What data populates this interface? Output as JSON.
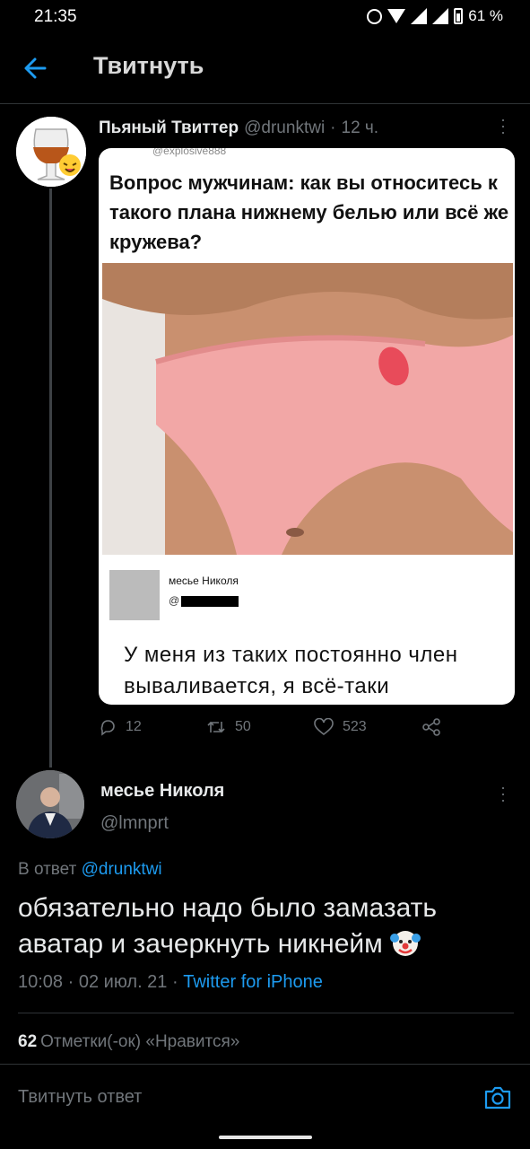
{
  "status_bar": {
    "time": "21:35",
    "battery": "61 %"
  },
  "header": {
    "title": "Твитнуть",
    "back_icon": "arrow-left-icon"
  },
  "quoted_tweet": {
    "name": "Пьяный Твиттер",
    "handle": "@drunktwi",
    "separator": "·",
    "time": "12 ч.",
    "card": {
      "clipped_handle": "@explosive888",
      "question": "Вопрос мужчинам: как вы относитесь к такого плана нижнему белью или всё же кружева?",
      "reply_name": "месье Николя",
      "reply_handle": "@",
      "reply_text": "У меня из таких постоянно член вываливается, я всё-таки"
    },
    "actions": {
      "replies": "12",
      "retweets": "50",
      "likes": "523"
    }
  },
  "main_tweet": {
    "name": "месье Николя",
    "handle": "@lmnprt",
    "replying_prefix": "В ответ",
    "replying_to": "@drunktwi",
    "text": "обязательно надо было замазать аватар и зачеркнуть никнейм",
    "emoji": "clown-face-icon",
    "time": "10:08",
    "date": "02 июл. 21",
    "separator": "·",
    "source": "Twitter for iPhone",
    "likes_count": "62",
    "likes_label": "Отметки(-ок) «Нравится»"
  },
  "reply_bar": {
    "placeholder": "Твитнуть ответ"
  },
  "colors": {
    "background": "#000000",
    "accent": "#1d9bf0",
    "muted": "#71767b",
    "text": "#e7e9ea"
  }
}
